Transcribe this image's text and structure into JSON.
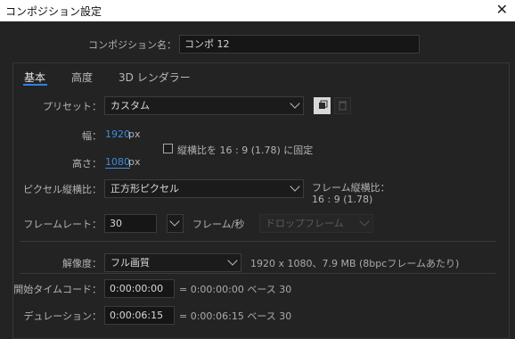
{
  "window": {
    "title": "コンポジション設定"
  },
  "composition": {
    "name_label": "コンポジション名：",
    "name_value": "コンポ 12"
  },
  "tabs": [
    "基本",
    "高度",
    "3D レンダラー"
  ],
  "preset": {
    "label": "プリセット：",
    "value": "カスタム"
  },
  "width": {
    "label": "幅：",
    "value": "1920",
    "unit": "px"
  },
  "height": {
    "label": "高さ：",
    "value": "1080",
    "unit": "px"
  },
  "lock_aspect": {
    "label": "縦横比を 16 : 9 (1.78) に固定",
    "checked": false
  },
  "pixel_aspect": {
    "label": "ピクセル縦横比：",
    "value": "正方形ピクセル",
    "frame_aspect_label": "フレーム縦横比：",
    "frame_aspect_value": "16 : 9 (1.78)"
  },
  "frame_rate": {
    "label": "フレームレート：",
    "value": "30",
    "unit": "フレーム/秒",
    "drop_frame": "ドロップフレーム"
  },
  "resolution": {
    "label": "解像度：",
    "value": "フル画質",
    "info": "1920 x 1080、7.9 MB (8bpcフレームあたり)"
  },
  "start_timecode": {
    "label": "開始タイムコード：",
    "value": "0:00:00:00",
    "info": "= 0:00:00:00  ベース 30"
  },
  "duration": {
    "label": "デュレーション：",
    "value": "0:00:06:15",
    "info": "= 0:00:06:15  ベース 30"
  }
}
